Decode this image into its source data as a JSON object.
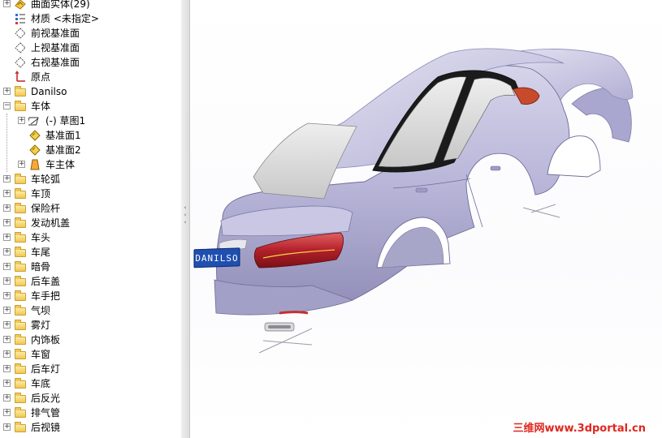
{
  "tree": {
    "items": [
      {
        "label": "曲面实体(29)",
        "icon": "surface-body-icon",
        "expander": "+"
      },
      {
        "label": "材质 <未指定>",
        "icon": "material-icon",
        "expander": ""
      },
      {
        "label": "前视基准面",
        "icon": "plane-icon",
        "expander": ""
      },
      {
        "label": "上视基准面",
        "icon": "plane-icon",
        "expander": ""
      },
      {
        "label": "右视基准面",
        "icon": "plane-icon",
        "expander": ""
      },
      {
        "label": "原点",
        "icon": "origin-icon",
        "expander": ""
      },
      {
        "label": "Danilso",
        "icon": "folder-icon",
        "expander": "+"
      },
      {
        "label": "车体",
        "icon": "folder-icon",
        "expander": "-"
      },
      {
        "label": "(-) 草图1",
        "icon": "sketch-icon",
        "expander": "+"
      },
      {
        "label": "基准面1",
        "icon": "plane-yellow-icon",
        "expander": ""
      },
      {
        "label": "基准面2",
        "icon": "plane-yellow-icon",
        "expander": ""
      },
      {
        "label": "车主体",
        "icon": "feature-icon",
        "expander": "+"
      },
      {
        "label": "车轮弧",
        "icon": "folder-icon",
        "expander": "+"
      },
      {
        "label": "车顶",
        "icon": "folder-icon",
        "expander": "+"
      },
      {
        "label": "保险杆",
        "icon": "folder-icon",
        "expander": "+"
      },
      {
        "label": "发动机盖",
        "icon": "folder-icon",
        "expander": "+"
      },
      {
        "label": "车头",
        "icon": "folder-icon",
        "expander": "+"
      },
      {
        "label": "车尾",
        "icon": "folder-icon",
        "expander": "+"
      },
      {
        "label": "暗骨",
        "icon": "folder-icon",
        "expander": "+"
      },
      {
        "label": "后车盖",
        "icon": "folder-icon",
        "expander": "+"
      },
      {
        "label": "车手把",
        "icon": "folder-icon",
        "expander": "+"
      },
      {
        "label": "气坝",
        "icon": "folder-icon",
        "expander": "+"
      },
      {
        "label": "雾灯",
        "icon": "folder-icon",
        "expander": "+"
      },
      {
        "label": "内饰板",
        "icon": "folder-icon",
        "expander": "+"
      },
      {
        "label": "车窗",
        "icon": "folder-icon",
        "expander": "+"
      },
      {
        "label": "后车灯",
        "icon": "folder-icon",
        "expander": "+"
      },
      {
        "label": "车底",
        "icon": "folder-icon",
        "expander": "+"
      },
      {
        "label": "后反光",
        "icon": "folder-icon",
        "expander": "+"
      },
      {
        "label": "排气管",
        "icon": "folder-icon",
        "expander": "+"
      },
      {
        "label": "后视镜",
        "icon": "folder-icon",
        "expander": "+"
      }
    ]
  },
  "viewport": {
    "plate_text": "DANILSO",
    "watermark": "三维网www.3dportal.cn"
  },
  "colors": {
    "body": "#b9b6d9",
    "tail_light": "#b3202a",
    "plate": "#1f4fb0",
    "watermark": "#e0271f"
  }
}
